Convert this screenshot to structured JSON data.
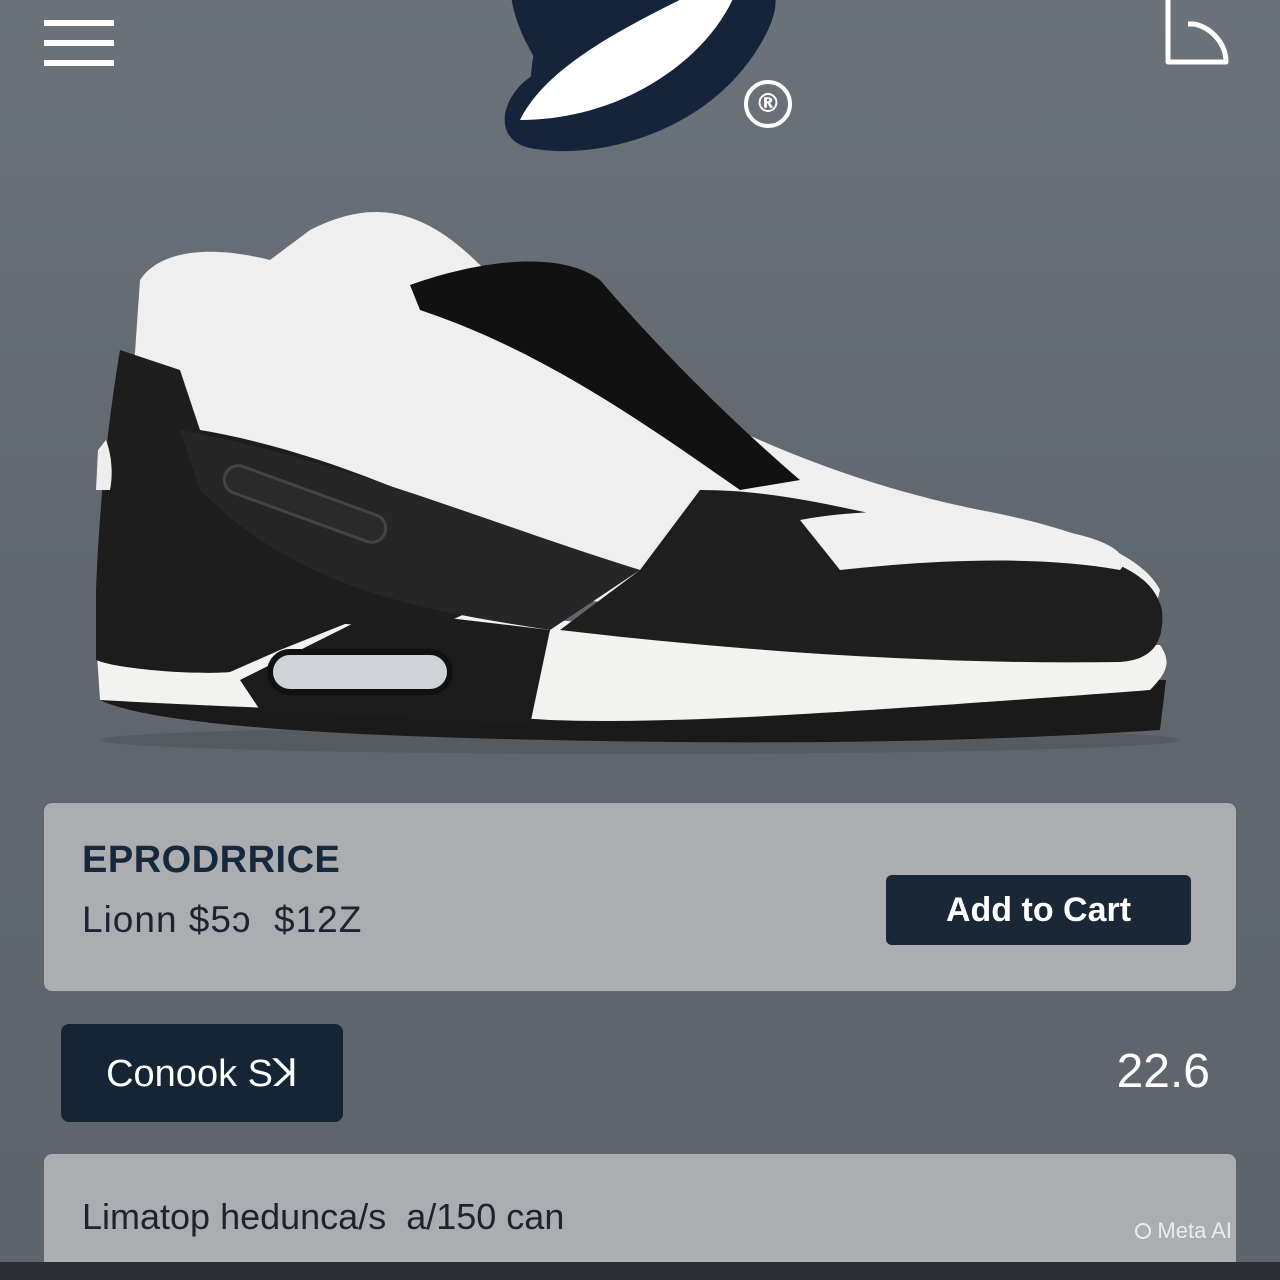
{
  "header": {
    "menu_icon": "hamburger-menu-icon",
    "logo_icon": "brand-leaf-logo",
    "registered_mark": "®",
    "cart_icon": "shopping-bag-icon"
  },
  "product": {
    "image_description_icon": "sneaker-image",
    "name": "EPRODRRICE",
    "price_line": "Lionn $5ↄ  $12Z",
    "add_to_cart_label": "Add to Cart"
  },
  "options": {
    "button_label": "Conook Sꓘ",
    "size_value": "22.6"
  },
  "info": {
    "text": "Limatop hedunca/s  a/150 can",
    "watermark": "Meta AI"
  },
  "colors": {
    "background": "#636a72",
    "card": "#abadb1",
    "navy": "#162536",
    "white": "#ffffff"
  }
}
